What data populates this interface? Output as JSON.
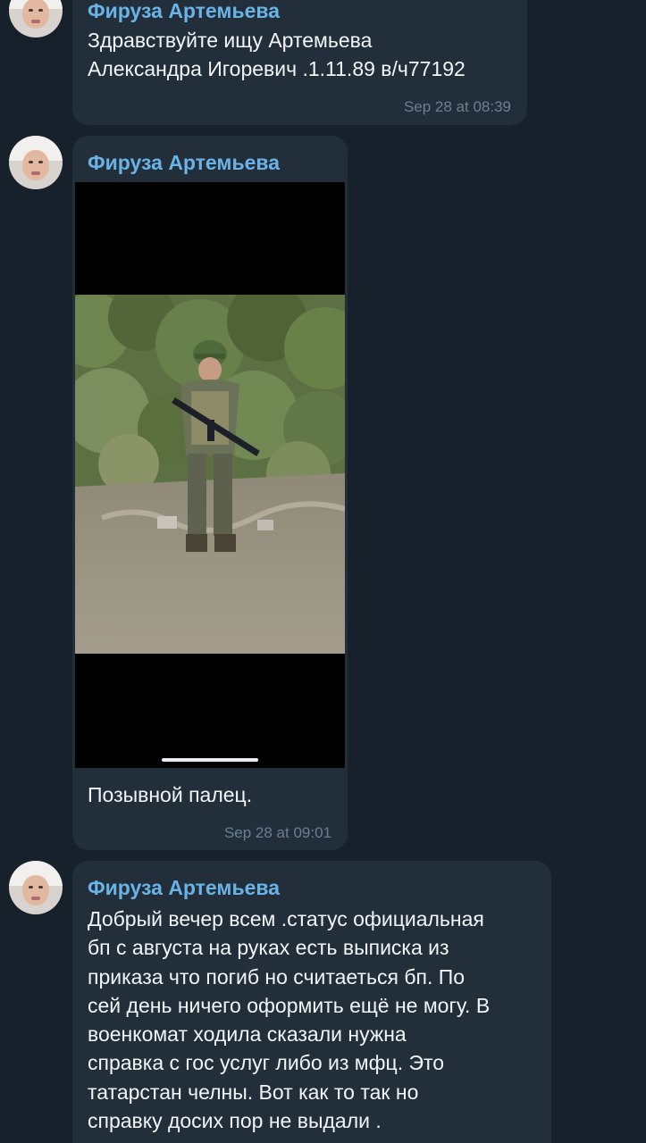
{
  "messages": [
    {
      "sender": "Фируза Артемьева",
      "text": "Здравствуйте ищу Артемьева\nАлександра Игоревич .1.11.89 в/ч77192",
      "time": "Sep 28 at 08:39"
    },
    {
      "sender": "Фируза Артемьева",
      "media": "photo-of-soldier-in-helmet-with-rifle",
      "text": "Позывной палец.",
      "time": "Sep 28 at 09:01"
    },
    {
      "sender": "Фируза Артемьева",
      "text": "Добрый вечер всем .статус официальная\nбп с августа  на руках есть выписка из\nприказа что погиб но считаеться бп. По\nсей день ничего оформить ещё не могу. В\nвоенкомат ходила сказали нужна\nсправка с гос услуг либо из мфц. Это\nтатарстан челны. Вот как то так но\nсправку досих пор не выдали ."
    }
  ],
  "colors": {
    "background": "#17212b",
    "bubble": "#222e3a",
    "sender": "#6ab3e6",
    "text": "#f2f5f8",
    "time": "#6b7f93"
  }
}
